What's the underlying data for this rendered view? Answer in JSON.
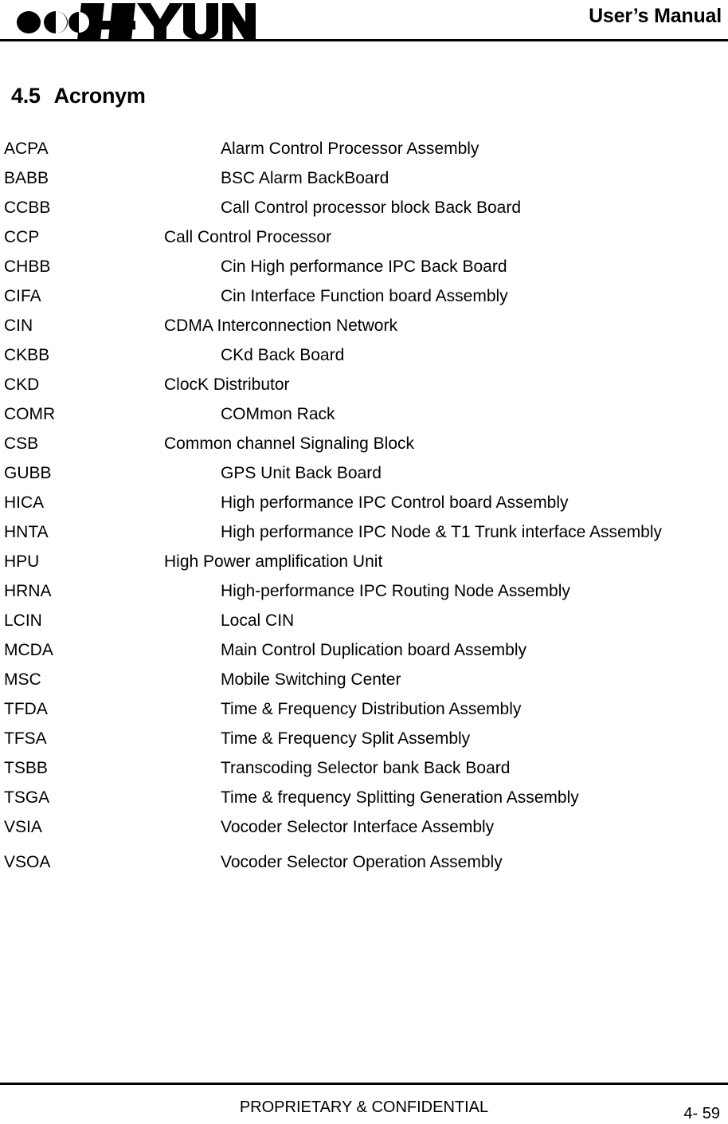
{
  "header": {
    "logo_text": "HYUNDAI",
    "logo_name": "hyundai-logo",
    "title": "User’s Manual"
  },
  "section": {
    "number": "4.5",
    "title": "Acronym"
  },
  "acronyms": [
    {
      "term": "ACPA",
      "definition": "Alarm Control Processor Assembly",
      "indent": 2
    },
    {
      "term": "BABB",
      "definition": "BSC Alarm BackBoard",
      "indent": 2
    },
    {
      "term": "CCBB",
      "definition": "Call Control processor block Back Board",
      "indent": 2
    },
    {
      "term": "CCP",
      "definition": "Call Control Processor",
      "indent": 1
    },
    {
      "term": "CHBB",
      "definition": "Cin High performance IPC Back Board",
      "indent": 2
    },
    {
      "term": "CIFA",
      "definition": "Cin Interface Function board Assembly",
      "indent": 2
    },
    {
      "term": "CIN",
      "definition": "CDMA Interconnection Network",
      "indent": 1
    },
    {
      "term": "CKBB",
      "definition": "CKd Back Board",
      "indent": 2
    },
    {
      "term": "CKD",
      "definition": "ClocK Distributor",
      "indent": 1
    },
    {
      "term": "COMR",
      "definition": "COMmon Rack",
      "indent": 2
    },
    {
      "term": "CSB",
      "definition": "Common channel Signaling Block",
      "indent": 1
    },
    {
      "term": "GUBB",
      "definition": "GPS Unit Back Board",
      "indent": 2
    },
    {
      "term": "HICA",
      "definition": "High performance IPC Control board Assembly",
      "indent": 2
    },
    {
      "term": "HNTA",
      "definition": "High performance IPC Node & T1 Trunk interface Assembly",
      "indent": 2
    },
    {
      "term": "HPU",
      "definition": "High Power amplification Unit",
      "indent": 1
    },
    {
      "term": "HRNA",
      "definition": "High-performance IPC Routing Node Assembly",
      "indent": 2
    },
    {
      "term": "LCIN",
      "definition": "Local CIN",
      "indent": 2
    },
    {
      "term": "MCDA",
      "definition": "Main Control Duplication board Assembly",
      "indent": 2
    },
    {
      "term": "MSC",
      "definition": "Mobile Switching Center",
      "indent": 2
    },
    {
      "term": "TFDA",
      "definition": "Time & Frequency Distribution Assembly",
      "indent": 2
    },
    {
      "term": "TFSA",
      "definition": "Time & Frequency Split Assembly",
      "indent": 2
    },
    {
      "term": "TSBB",
      "definition": "Transcoding Selector bank Back Board",
      "indent": 2
    },
    {
      "term": "TSGA",
      "definition": "Time & frequency Splitting Generation Assembly",
      "indent": 2
    },
    {
      "term": "VSIA",
      "definition": "Vocoder Selector Interface Assembly",
      "indent": 2
    },
    {
      "term": "VSOA",
      "definition": "Vocoder Selector Operation Assembly",
      "indent": 2,
      "gap_before": true
    }
  ],
  "footer": {
    "notice": "PROPRIETARY & CONFIDENTIAL",
    "page_number": "4- 59"
  },
  "colors": {
    "ink": "#000000",
    "paper": "#ffffff"
  }
}
